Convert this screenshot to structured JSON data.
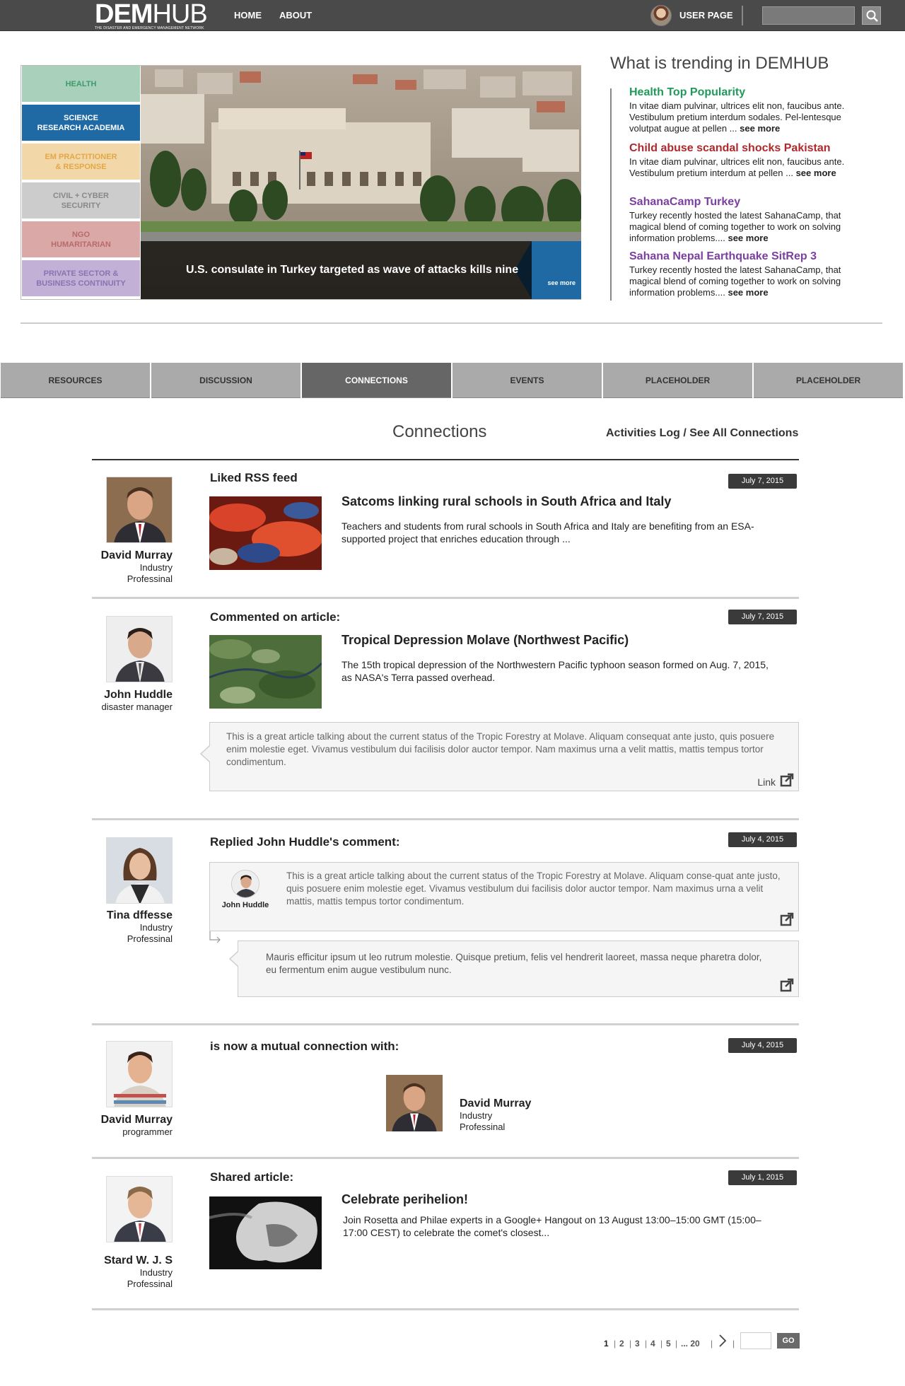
{
  "header": {
    "logo_bold": "DEM",
    "logo_light": "HUB",
    "logo_tagline": "THE DISASTER AND EMERGENCY MANAGEMENT NETWORK",
    "nav": [
      "HOME",
      "ABOUT"
    ],
    "user_label": "USER PAGE",
    "search_placeholder": ""
  },
  "hero": {
    "categories": [
      {
        "label": "HEALTH",
        "bg": "#a8d0bb",
        "fg": "#3f9a6b"
      },
      {
        "label": "SCIENCE\nRESEARCH ACADEMIA",
        "bg": "#1f6aa5",
        "fg": "#ffffff"
      },
      {
        "label": "EM PRACTITIONER\n& RESPONSE",
        "bg": "#f2d8a8",
        "fg": "#e3a745"
      },
      {
        "label": "CIVIL + CYBER\nSECURITY",
        "bg": "#cccccc",
        "fg": "#888888"
      },
      {
        "label": "NGO\nHUMARITARIAN",
        "bg": "#dba8a8",
        "fg": "#b86a6a"
      },
      {
        "label": "PRIVATE SECTOR &\nBUSINESS CONTINUITY",
        "bg": "#c2b0d6",
        "fg": "#8c72b0"
      }
    ],
    "caption": "U.S. consulate in Turkey targeted as wave of attacks kills nine",
    "see_more": "see more"
  },
  "trending": {
    "title": "What is trending in DEMHUB",
    "items": [
      {
        "title": "Health Top Popularity",
        "color": "#1f9a5a",
        "text": "In vitae diam pulvinar, ultrices elit non, faucibus ante. Vestibulum pretium interdum sodales. Pel-lentesque volutpat augue at pellen ...",
        "more": "see more"
      },
      {
        "title": "Child abuse scandal shocks Pakistan",
        "color": "#b0282c",
        "text": "In vitae diam pulvinar, ultrices elit non, faucibus ante. Vestibulum pretium interdum at pellen ...",
        "more": "see more"
      },
      {
        "title": "SahanaCamp Turkey",
        "color": "#7a3fa0",
        "text": "Turkey recently hosted the latest SahanaCamp, that magical blend of coming together to work on solving information problems....",
        "more": "see more"
      },
      {
        "title": "Sahana Nepal Earthquake SitRep 3",
        "color": "#7a3fa0",
        "text": "Turkey recently hosted the latest SahanaCamp, that magical blend of coming together to work on solving information problems....",
        "more": "see more"
      }
    ]
  },
  "tabs": [
    "RESOURCES",
    "DISCUSSION",
    "CONNECTIONS",
    "EVENTS",
    "PLACEHOLDER",
    "PLACEHOLDER"
  ],
  "active_tab": 2,
  "section": {
    "title": "Connections",
    "activities_log": "Activities Log",
    "slash": " / ",
    "see_all": "See All Connections"
  },
  "feed": [
    {
      "person": {
        "name": "David Murray",
        "role_lines": [
          "Industry",
          "Professinal"
        ]
      },
      "action": "Liked RSS feed",
      "date": "July 7, 2015",
      "article_title": "Satcoms linking rural schools in South Africa and Italy",
      "article_desc": "Teachers and students from rural schools in South Africa and Italy are benefiting from an ESA-supported project that enriches education through ..."
    },
    {
      "person": {
        "name": "John Huddle",
        "role_lines": [
          "disaster manager"
        ]
      },
      "action": "Commented on article:",
      "date": "July 7, 2015",
      "article_title": "Tropical Depression Molave (Northwest Pacific)",
      "article_desc": "The 15th tropical depression of the Northwestern Pacific typhoon season formed on Aug. 7, 2015, as NASA's Terra passed overhead.",
      "comment": "This is a great article talking about the current status of the Tropic Forestry at Molave. Aliquam consequat ante justo, quis posuere enim molestie eget. Vivamus vestibulum dui facilisis dolor auctor tempor. Nam maximus urna a velit mattis, mattis tempus tortor condimentum.",
      "link_label": "Link"
    },
    {
      "person": {
        "name": "Tina dffesse",
        "role_lines": [
          "Industry",
          "Professinal"
        ]
      },
      "action": "Replied John Huddle's comment:",
      "date": "July 4, 2015",
      "quoted_author": "John Huddle",
      "quoted_comment": "This is a great article talking about the current status of the Tropic Forestry at Molave. Aliquam conse-quat ante justo, quis posuere enim molestie eget. Vivamus vestibulum dui facilisis dolor auctor tempor. Nam maximus urna a velit mattis, mattis tempus tortor condimentum.",
      "reply": "Mauris efficitur ipsum ut leo rutrum molestie. Quisque pretium, felis vel hendrerit laoreet, massa neque pharetra dolor, eu fermentum enim augue vestibulum nunc."
    },
    {
      "person": {
        "name": "David Murray",
        "role_lines": [
          "programmer"
        ]
      },
      "action": "is now a mutual connection with:",
      "date": "July 4, 2015",
      "connection": {
        "name": "David Murray",
        "role_lines": [
          "Industry",
          "Professinal"
        ]
      }
    },
    {
      "person": {
        "name": "Stard W. J. S",
        "role_lines": [
          "Industry",
          "Professinal"
        ]
      },
      "action": "Shared article:",
      "date": "July 1, 2015",
      "article_title": "Celebrate perihelion!",
      "article_desc": "Join Rosetta and Philae experts in a Google+ Hangout on 13 August 13:00–15:00 GMT (15:00–17:00 CEST) to celebrate the comet's closest..."
    }
  ],
  "pagination": {
    "pages": [
      "1",
      "2",
      "3",
      "4",
      "5",
      "... 20"
    ],
    "separator": "|",
    "next_icon": "chevron-right",
    "go_label": "GO"
  }
}
